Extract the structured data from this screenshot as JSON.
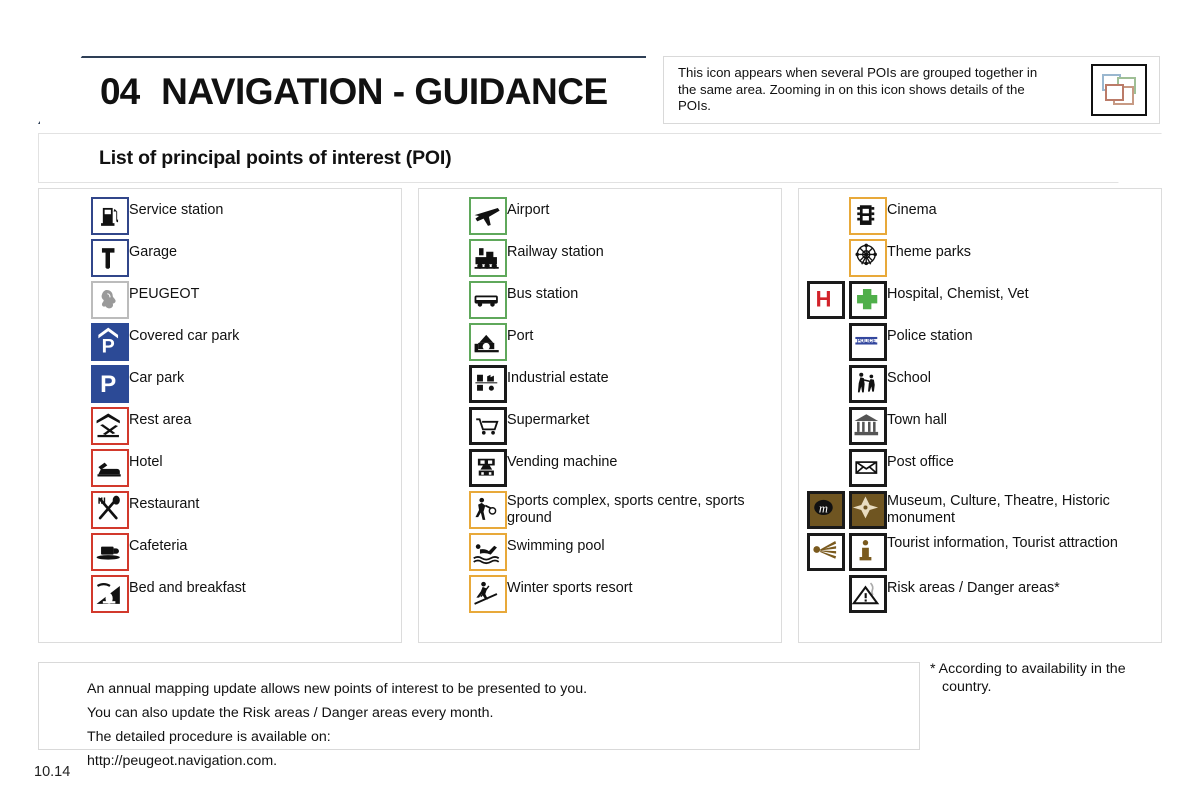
{
  "header": {
    "chapter_number": "04",
    "chapter_title": "NAVIGATION - GUIDANCE",
    "info_text": "This icon appears when several POIs are grouped together in the same area. Zooming in on this icon shows details of the POIs.",
    "group_icon_name": "grouped-pois-icon"
  },
  "subtitle": "List of principal points of interest (POI)",
  "columns": [
    {
      "id": "column-1",
      "items": [
        {
          "label": "Service station",
          "icons": [
            "fuel-pump-icon"
          ]
        },
        {
          "label": "Garage",
          "icons": [
            "wrench-icon"
          ]
        },
        {
          "label": "PEUGEOT",
          "icons": [
            "peugeot-lion-icon"
          ]
        },
        {
          "label": "Covered car park",
          "icons": [
            "covered-parking-icon"
          ]
        },
        {
          "label": "Car park",
          "icons": [
            "parking-icon"
          ]
        },
        {
          "label": "Rest area",
          "icons": [
            "rest-area-icon"
          ]
        },
        {
          "label": "Hotel",
          "icons": [
            "hotel-bed-icon"
          ]
        },
        {
          "label": "Restaurant",
          "icons": [
            "restaurant-cutlery-icon"
          ]
        },
        {
          "label": "Cafeteria",
          "icons": [
            "coffee-cup-icon"
          ]
        },
        {
          "label": "Bed and breakfast",
          "icons": [
            "bed-and-breakfast-icon"
          ]
        }
      ]
    },
    {
      "id": "column-2",
      "items": [
        {
          "label": "Airport",
          "icons": [
            "airplane-icon"
          ]
        },
        {
          "label": "Railway station",
          "icons": [
            "train-icon"
          ]
        },
        {
          "label": "Bus station",
          "icons": [
            "bus-icon"
          ]
        },
        {
          "label": "Port",
          "icons": [
            "port-ship-icon"
          ]
        },
        {
          "label": "Industrial estate",
          "icons": [
            "industrial-estate-icon"
          ]
        },
        {
          "label": "Supermarket",
          "icons": [
            "shopping-trolley-icon"
          ]
        },
        {
          "label": "Vending machine",
          "icons": [
            "vending-machine-icon"
          ]
        },
        {
          "label": "Sports complex, sports centre, sports ground",
          "icons": [
            "sports-complex-icon"
          ]
        },
        {
          "label": "Swimming pool",
          "icons": [
            "swimmer-icon"
          ]
        },
        {
          "label": "Winter sports resort",
          "icons": [
            "skier-icon"
          ]
        }
      ]
    },
    {
      "id": "column-3",
      "items": [
        {
          "label": "Cinema",
          "icons": [
            "film-reel-icon"
          ]
        },
        {
          "label": "Theme parks",
          "icons": [
            "ferris-wheel-icon"
          ]
        },
        {
          "label": "Hospital, Chemist, Vet",
          "icons": [
            "hospital-h-icon",
            "green-cross-icon"
          ]
        },
        {
          "label": "Police station",
          "icons": [
            "police-sign-icon"
          ]
        },
        {
          "label": "School",
          "icons": [
            "school-children-icon"
          ]
        },
        {
          "label": "Town hall",
          "icons": [
            "town-hall-icon"
          ]
        },
        {
          "label": "Post office",
          "icons": [
            "envelope-icon"
          ]
        },
        {
          "label": "Museum, Culture, Theatre, Historic monument",
          "icons": [
            "museum-m-icon",
            "historic-monument-icon"
          ]
        },
        {
          "label": "Tourist information, Tourist attraction",
          "icons": [
            "tourist-attraction-icon",
            "tourist-information-icon"
          ]
        },
        {
          "label": "Risk areas / Danger areas*",
          "icons": [
            "danger-warning-icon"
          ]
        }
      ]
    }
  ],
  "footer": {
    "lines": [
      "An annual mapping update allows new points of interest to be presented to you.",
      "You can also update the Risk areas / Danger areas every month.",
      "The detailed procedure is available on:",
      "http://peugeot.navigation.com."
    ],
    "footnote_line1": "* According to availability in the",
    "footnote_line2": "country."
  },
  "page_number": "10.14",
  "colors": {
    "blue_border": "#31468a",
    "blue_fill": "#2c4a96",
    "red_border": "#d2392c",
    "green_border": "#5fa85b",
    "orange_border": "#e8a93a",
    "black_border": "#1a1a1a",
    "brown_fill": "#6f5521",
    "header_border": "#2e3f56"
  }
}
